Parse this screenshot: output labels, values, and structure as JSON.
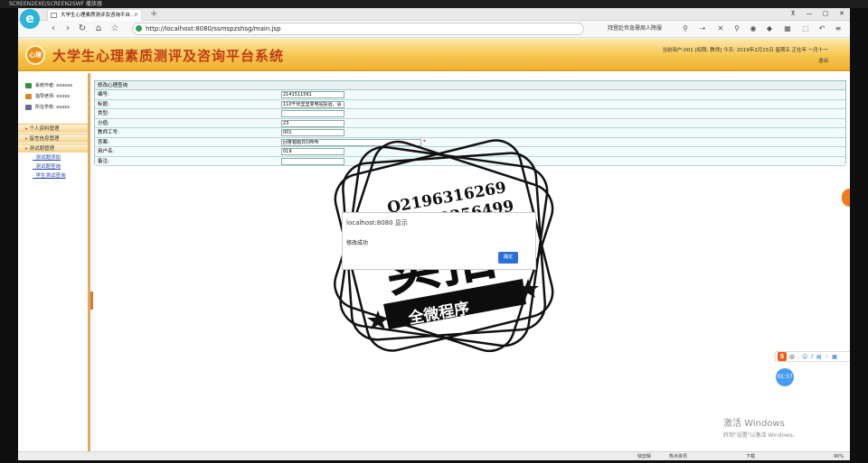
{
  "player": {
    "title": "SCREEN2EXE/SCREEN2SWF 播放器"
  },
  "browser": {
    "logo": "e",
    "tab_title": "大学生心理素质测评及咨询平台...",
    "url": "http://localhost:8080/ssmspzshsg/main.jsp",
    "news": "拜登赴世急需周人降服",
    "window_buttons": [
      "⊼",
      "—",
      "▢",
      "✕"
    ],
    "nav": [
      "‹",
      "›",
      "↻",
      "⌂",
      "☆"
    ],
    "tools": [
      "⚲",
      "⇢",
      "✕",
      "⚲",
      "◉",
      "◆",
      "▦",
      "⬚",
      "↶",
      "≡"
    ]
  },
  "site": {
    "logo": "心理",
    "title": "大学生心理素质测评及咨询平台系统",
    "user_info": "当前用户:001 [权限: 教师] 今天: 2019年2月15日 星期五 正在年 一月十一",
    "logout": "退出"
  },
  "sidebar": {
    "info": [
      {
        "label": "系统作者: xxxxxx",
        "icon": "user-icon",
        "color": "#3a8f3a"
      },
      {
        "label": "指导老师: xxxxx",
        "icon": "teacher-icon",
        "color": "#d98a1c"
      },
      {
        "label": "所在学校: xxxxx",
        "icon": "school-icon",
        "color": "#6a6a9a"
      }
    ],
    "menu": [
      {
        "label": "个人资料管理",
        "items": []
      },
      {
        "label": "留言信息管理",
        "items": []
      },
      {
        "label": "测试题管理",
        "items": [
          "测试题添加",
          "测试题查询",
          "学生测试查询"
        ]
      }
    ]
  },
  "form": {
    "caption": "修改心理查询",
    "rows": [
      {
        "label": "编号:",
        "value": "2141511561",
        "width": 70
      },
      {
        "label": "标题:",
        "value": "110千伏里里变电站投运，请",
        "width": 70
      },
      {
        "label": "类型:",
        "value": "",
        "width": 70
      },
      {
        "label": "分值:",
        "value": "23",
        "width": 70
      },
      {
        "label": "教师工号:",
        "value": "001",
        "width": 70
      },
      {
        "label": "答案:",
        "value": "回答错题日同听听",
        "width": 155,
        "required": "*"
      },
      {
        "label": "用户名:",
        "value": "019",
        "width": 70
      },
      {
        "label": "备注:",
        "value": "",
        "width": 70
      }
    ]
  },
  "dialog": {
    "host": "localhost:8080 显示",
    "message": "修改成功",
    "ok": "确定"
  },
  "watermark": {
    "line1": "Q2196316269",
    "line2": "V17060256499",
    "main": "实拍",
    "banner": "全微程序"
  },
  "status": {
    "items": [
      "快剪辑",
      "热点资讯",
      "下载",
      "90%"
    ]
  },
  "windows": {
    "activate_title": "激活 Windows",
    "activate_hint": "转到\"设置\"以激活 Windows。"
  },
  "ime": {
    "logo": "S",
    "mode": "中"
  },
  "timer": "01:37"
}
